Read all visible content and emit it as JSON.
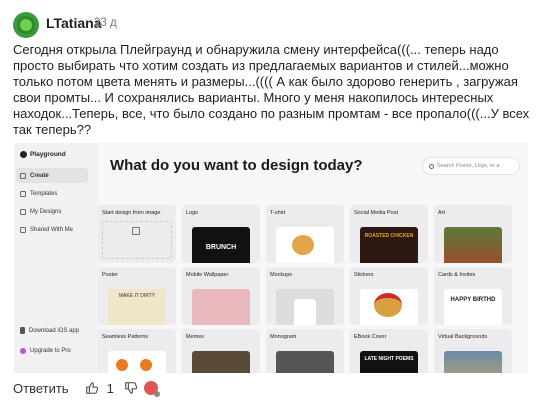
{
  "comment": {
    "author": "LTatiana",
    "time_ago": "23 д",
    "text": "Сегодня открыла Плейграунд и обнаружила смену интерфейса(((... теперь надо просто выбирать что хотим создать из предлагаемых вариантов и стилей...можно только потом цвета менять и размеры...(((( А как было здорово генерить , загружая свои промты... И сохранялись варианты. Много у меня накопилось интересных находок...Теперь, все, что было создано по разным промтам - все пропало(((...У всех так теперь??"
  },
  "screenshot": {
    "brand": "Playground",
    "nav": [
      "Create",
      "Templates",
      "My Designs",
      "Shared With Me"
    ],
    "bottom_nav": [
      "Download iOS app",
      "Upgrade to Pro"
    ],
    "heading": "What do you want to design today?",
    "search_placeholder": "Search Poster, Logo, or a",
    "cards": [
      "Start design from image",
      "Logo",
      "T-shirt",
      "Social Media Post",
      "Art",
      "Poster",
      "Mobile Wallpaper",
      "Mockups",
      "Stickers",
      "Cards & Invites",
      "Seamless Patterns",
      "Memes",
      "Monogram",
      "EBook Cover",
      "Virtual Backgrounds"
    ],
    "card_art_text": {
      "logo": "BRUNCH",
      "social": "ROASTED CHICKEN",
      "poster": "MAKE IT DIRTY",
      "cards": "HAPPY BIRTHD",
      "ebook": "LATE NIGHT POEMS"
    }
  },
  "actions": {
    "reply_label": "Ответить",
    "like_count": "1"
  },
  "colors": {
    "accent_green": "#3b9a3b",
    "text": "#1f1f1f",
    "muted": "#7a7a7a"
  }
}
